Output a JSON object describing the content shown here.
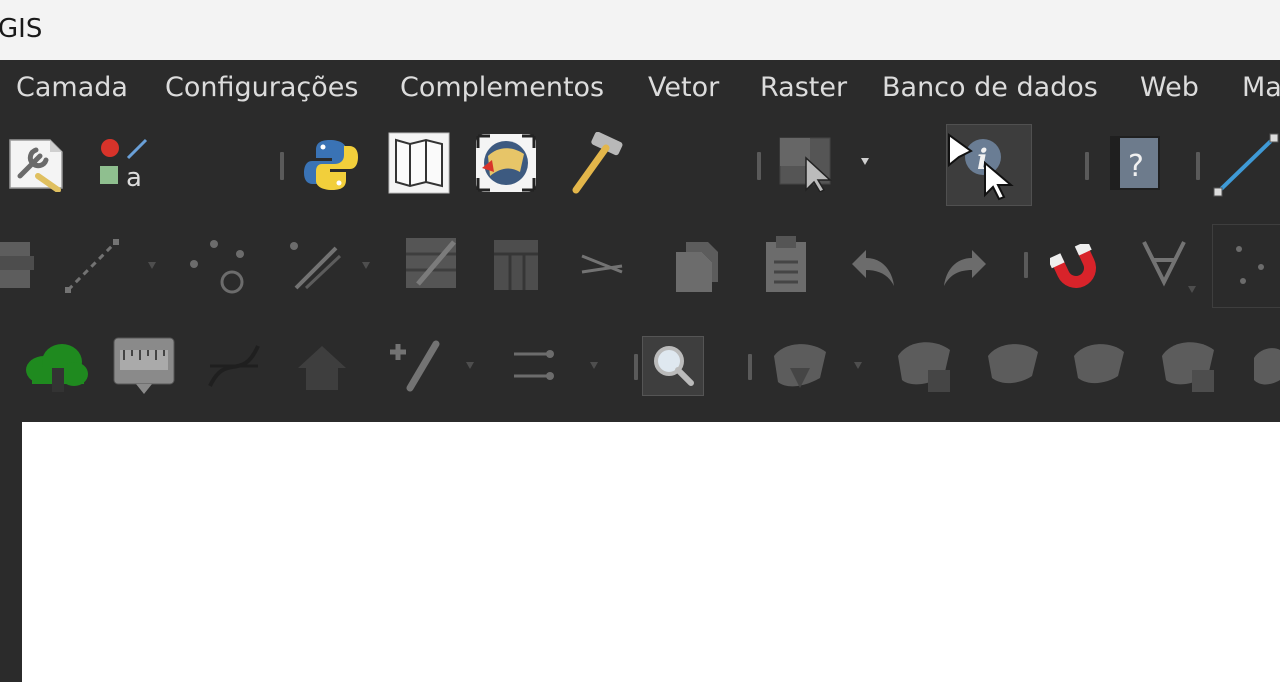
{
  "window": {
    "title": "GIS"
  },
  "menubar": {
    "items": [
      {
        "label": "Camada"
      },
      {
        "label": "Configurações"
      },
      {
        "label": "Complementos"
      },
      {
        "label": "Vetor"
      },
      {
        "label": "Raster"
      },
      {
        "label": "Banco de dados"
      },
      {
        "label": "Web"
      },
      {
        "label": "Ma"
      }
    ]
  },
  "toolbars": {
    "row1": [
      "style-manager-icon",
      "label-symbol-icon",
      "python-console-icon",
      "map-layout-icon",
      "georeferencer-icon",
      "processing-toolbox-icon",
      "select-features-icon",
      "identify-features-icon",
      "help-icon",
      "measure-line-icon"
    ],
    "row2": [
      "digitize-icon",
      "add-line-icon",
      "vertex-tool-icon",
      "split-features-icon",
      "edit-attributes-icon",
      "table-icon",
      "trim-icon",
      "copy-icon",
      "paste-icon",
      "undo-icon",
      "redo-icon",
      "snapping-magnet-icon",
      "topology-icon",
      "advanced-digitize-icon"
    ],
    "row3": [
      "cloud-upload-icon",
      "ruler-icon",
      "curve-icon",
      "home-icon",
      "add-edit-icon",
      "split-icon",
      "zoom-magnifier-icon",
      "map-layer-icon"
    ]
  },
  "colors": {
    "background": "#2b2b2b",
    "titlebar": "#f3f3f3",
    "menu_text": "#dcdcdc",
    "canvas": "#ffffff",
    "magnet_red": "#d8232a",
    "cloud_green": "#1f8a1f"
  }
}
